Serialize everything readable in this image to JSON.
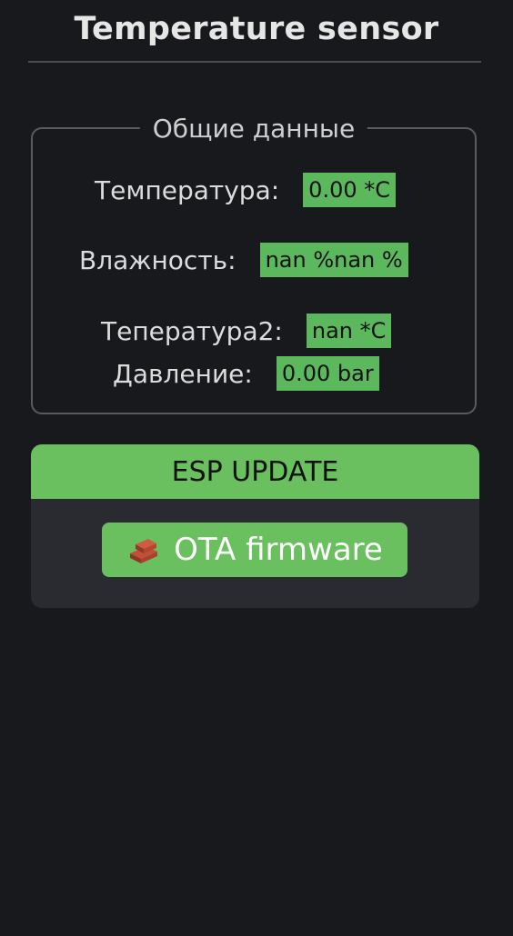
{
  "header": {
    "title": "Temperature sensor"
  },
  "general_data": {
    "legend": "Общие данные",
    "rows": [
      {
        "label": "Температура:",
        "value": "0.00 *C"
      },
      {
        "label": "Влажность:",
        "value": "nan %nan %"
      },
      {
        "label": "Тепература2:",
        "value": "nan *C"
      },
      {
        "label": "Давление:",
        "value": "0.00 bar"
      }
    ]
  },
  "update": {
    "header": "ESP UPDATE",
    "ota_button_label": "OTA firmware",
    "ota_icon": "bricks-icon"
  },
  "colors": {
    "background": "#18191d",
    "accent_green": "#6abf5e",
    "card_bg": "#2a2b31"
  }
}
